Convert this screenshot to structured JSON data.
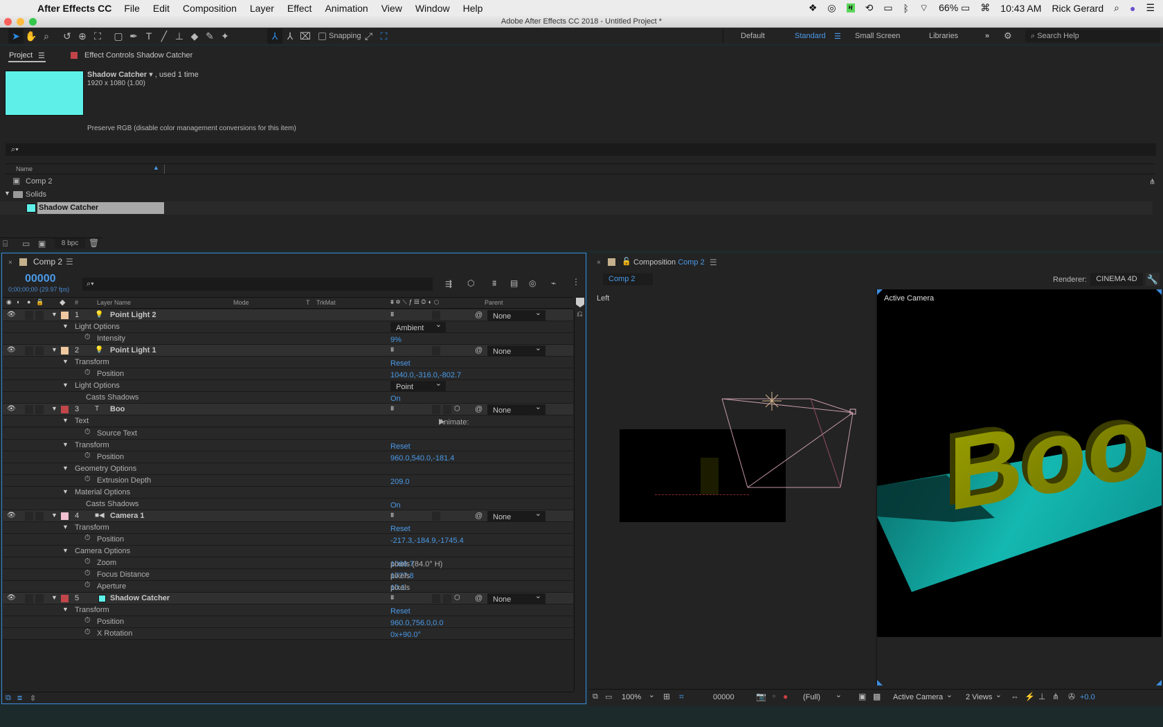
{
  "menubar": {
    "app_name": "After Effects CC",
    "items": [
      "File",
      "Edit",
      "Composition",
      "Layer",
      "Effect",
      "Animation",
      "View",
      "Window",
      "Help"
    ],
    "status": {
      "battery": "66%",
      "time": "10:43 AM",
      "user": "Rick Gerard",
      "green_badge": "ዛ"
    }
  },
  "window": {
    "title": "Adobe After Effects CC 2018 - Untitled Project *"
  },
  "toolbar": {
    "snapping_label": "Snapping",
    "workspaces": [
      "Default",
      "Standard",
      "Small Screen",
      "Libraries"
    ],
    "active_workspace": "Standard",
    "search_help_placeholder": "Search Help",
    "overflow": "»"
  },
  "project_panel": {
    "tab_project": "Project",
    "tab_effect_controls": "Effect Controls Shadow Catcher",
    "selected_item": {
      "name": "Shadow Catcher",
      "usage": ", used 1 time",
      "dimensions": "1920 x 1080 (1.00)",
      "color": "#5ef0e8"
    },
    "preserve_rgb": "Preserve RGB (disable color management conversions for this item)",
    "column_name": "Name",
    "items": [
      {
        "name": "Comp 2",
        "type": "comp"
      },
      {
        "name": "Solids",
        "type": "folder"
      },
      {
        "name": "Shadow Catcher",
        "type": "solid",
        "selected": true
      }
    ],
    "bpc": "8 bpc"
  },
  "timeline": {
    "tab": "Comp 2",
    "timecode": "00000",
    "timecode_sub": "0;00;00;00 (29.97 fps)",
    "columns": {
      "num": "#",
      "layer_name": "Layer Name",
      "mode": "Mode",
      "t": "T",
      "trkmat": "TrkMat",
      "parent": "Parent"
    },
    "rows": [
      {
        "kind": "layer",
        "num": "1",
        "name": "Point Light 2",
        "color": "#f0c8a0",
        "icon": "light",
        "parent": "None"
      },
      {
        "kind": "group",
        "name": "Light Options",
        "value_dd": "Ambient"
      },
      {
        "kind": "prop",
        "name": "Intensity",
        "value": "9%"
      },
      {
        "kind": "layer",
        "num": "2",
        "name": "Point Light 1",
        "color": "#f0c8a0",
        "icon": "light",
        "parent": "None"
      },
      {
        "kind": "group",
        "name": "Transform",
        "value": "Reset"
      },
      {
        "kind": "prop",
        "name": "Position",
        "value": "1040.0,-316.0,-802.7"
      },
      {
        "kind": "group",
        "name": "Light Options",
        "value_dd": "Point"
      },
      {
        "kind": "prop2",
        "name": "Casts Shadows",
        "value": "On"
      },
      {
        "kind": "layer",
        "num": "3",
        "name": "Boo",
        "color": "#c0464a",
        "icon": "text",
        "parent": "None"
      },
      {
        "kind": "group",
        "name": "Text",
        "animate": "Animate:"
      },
      {
        "kind": "prop",
        "name": "Source Text"
      },
      {
        "kind": "group",
        "name": "Transform",
        "value": "Reset"
      },
      {
        "kind": "prop",
        "name": "Position",
        "value": "960.0,540.0,-181.4"
      },
      {
        "kind": "group",
        "name": "Geometry Options"
      },
      {
        "kind": "prop",
        "name": "Extrusion Depth",
        "value": "209.0"
      },
      {
        "kind": "group",
        "name": "Material Options"
      },
      {
        "kind": "prop2",
        "name": "Casts Shadows",
        "value": "On"
      },
      {
        "kind": "layer",
        "num": "4",
        "name": "Camera 1",
        "color": "#f2c0d0",
        "icon": "camera",
        "parent": "None"
      },
      {
        "kind": "group",
        "name": "Transform",
        "value": "Reset"
      },
      {
        "kind": "prop",
        "name": "Position",
        "value": "-217.3,-184.9,-1745.4"
      },
      {
        "kind": "group",
        "name": "Camera Options"
      },
      {
        "kind": "prop",
        "name": "Zoom",
        "value": "1066.7",
        "unit": " pixels (84.0° H)"
      },
      {
        "kind": "prop",
        "name": "Focus Distance",
        "value": "1777.8",
        "unit": " pixels"
      },
      {
        "kind": "prop",
        "name": "Aperture",
        "value": "10.1",
        "unit": " pixels"
      },
      {
        "kind": "layer",
        "num": "5",
        "name": "Shadow Catcher",
        "color": "#c0464a",
        "icon": "solid",
        "parent": "None"
      },
      {
        "kind": "group",
        "name": "Transform",
        "value": "Reset"
      },
      {
        "kind": "prop",
        "name": "Position",
        "value": "960.0,756.0,0.0"
      },
      {
        "kind": "prop",
        "name": "X Rotation",
        "value": "0x+90.0°"
      }
    ]
  },
  "composition": {
    "panel_label": "Composition",
    "comp_name": "Comp 2",
    "flowchart_tab": "Comp 2",
    "renderer_label": "Renderer:",
    "renderer": "CINEMA 4D",
    "views": {
      "left": "Left",
      "right": "Active Camera"
    },
    "render_text": "Boo",
    "footer": {
      "zoom": "100%",
      "timecode": "00000",
      "resolution": "(Full)",
      "camera": "Active Camera",
      "layout": "2 Views",
      "exposure": "+0.0"
    }
  }
}
